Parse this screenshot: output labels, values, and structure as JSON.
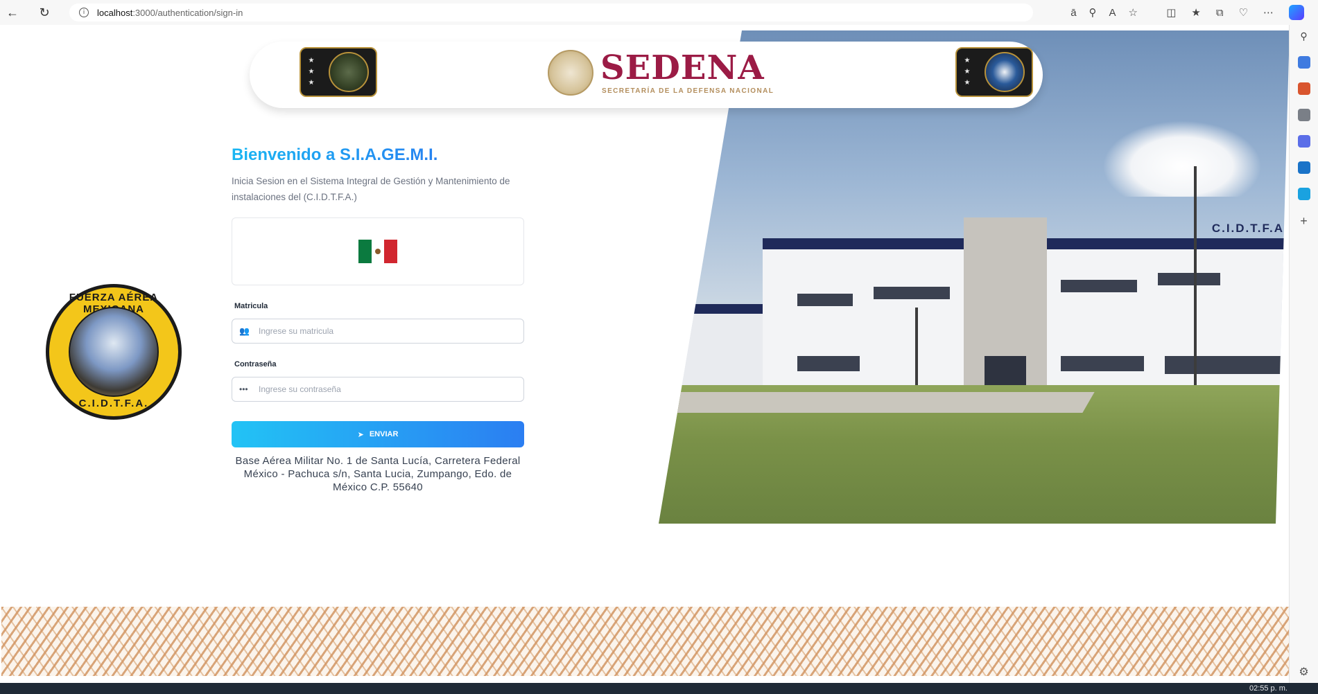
{
  "browser": {
    "url_host": "localhost",
    "url_path": ":3000/authentication/sign-in"
  },
  "header": {
    "brand": "SEDENA",
    "brand_subtitle": "SECRETARÍA DE LA DEFENSA NACIONAL"
  },
  "logo": {
    "top_text": "FUERZA AÉREA MEXICANA",
    "bottom_text": "C.I.D.T.F.A."
  },
  "form": {
    "title": "Bienvenido a S.I.A.GE.M.I.",
    "subtitle": "Inicia Sesion en el Sistema Integral de Gestión y Mantenimiento de instalaciones del (C.I.D.T.F.A.)",
    "matricula_label": "Matricula",
    "matricula_placeholder": "Ingrese su matricula",
    "password_label": "Contraseña",
    "password_placeholder": "Ingrese su contraseña",
    "submit_label": "ENVIAR",
    "address": "Base Aérea Militar No. 1 de Santa Lucía, Carretera Federal México - Pachuca s/n, Santa Lucia, Zumpango, Edo. de México C.P. 55640"
  },
  "photo": {
    "sign_text": "C.I.D.T.F.A"
  },
  "taskbar": {
    "clock": "02:55 p. m."
  },
  "colors": {
    "brand": "#9b1b45",
    "accent_start": "#19b6f2",
    "accent_end": "#2d6cf0"
  }
}
